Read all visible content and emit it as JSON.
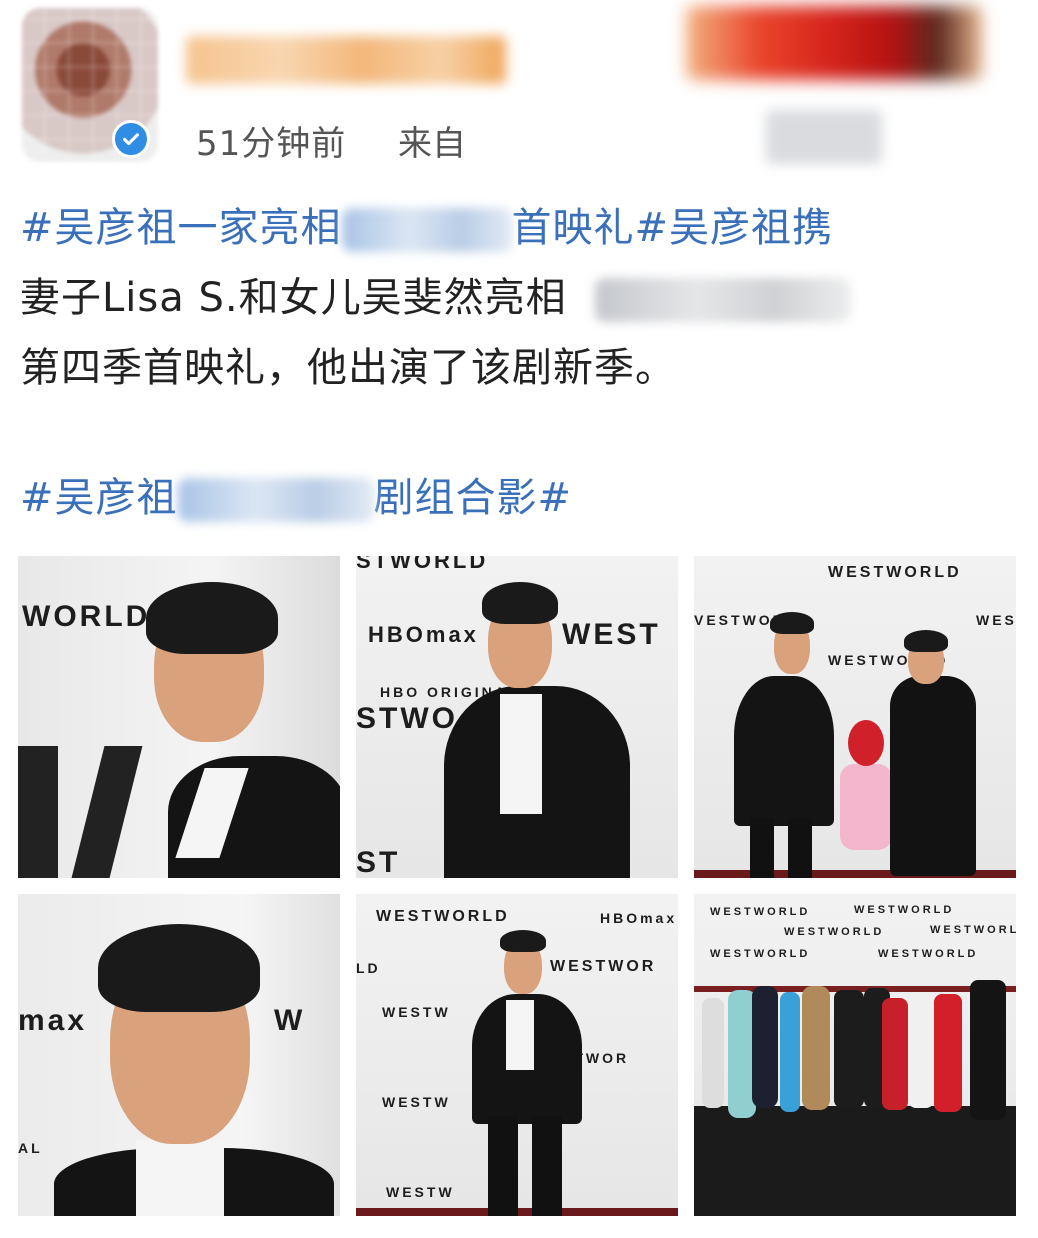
{
  "post": {
    "time": "51分钟前",
    "from_label": "来自",
    "line1_a": "#吴彦祖一家亮相",
    "line1_b": "首映礼#吴彦祖携",
    "line2": "妻子Lisa S.和女儿吴斐然亮相",
    "line3": "第四季首映礼，他出演了该剧新季。",
    "line4_a": "#吴彦祖",
    "line4_b": "剧组合影#"
  },
  "photos": {
    "backdrop_text": [
      "WORLD",
      "STWORLD",
      "HBOmax",
      "WEST",
      "HBO ORIGINAL",
      "STWO",
      "ST",
      "WESTWORLD",
      "WES",
      "VESTWORLD",
      "max",
      "W",
      "AL",
      "LD",
      "WESTWOR",
      "WESTW",
      "STWOR",
      "HBO"
    ]
  },
  "colors": {
    "hashtag": "#3a6fba",
    "text": "#222222",
    "meta": "#555555",
    "verified": "#2f8de4"
  }
}
